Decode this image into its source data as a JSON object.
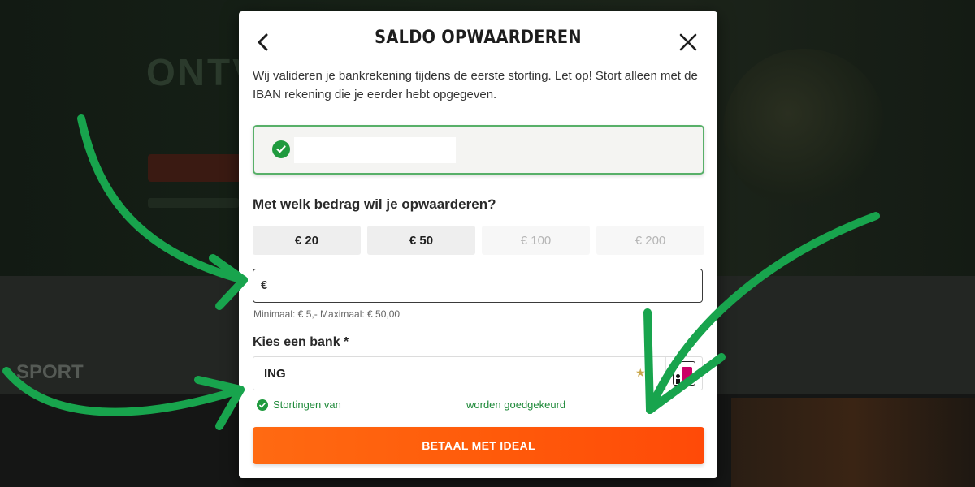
{
  "background": {
    "hero_title": "ONTVA",
    "section_label": "SPORT"
  },
  "modal": {
    "title": "SALDO OPWAARDEREN",
    "back_icon": "chevron-left-icon",
    "close_icon": "close-icon",
    "intro": "Wij valideren je bankrekening tijdens de eerste storting. Let op! Stort alleen met de IBAN rekening die je eerder hebt opgegeven.",
    "account_verified_icon": "check-circle-icon",
    "amount_question": "Met welk bedrag wil je opwaarderen?",
    "amount_options": [
      {
        "label": "€ 20",
        "state": "enabled"
      },
      {
        "label": "€ 50",
        "state": "enabled"
      },
      {
        "label": "€ 100",
        "state": "disabled"
      },
      {
        "label": "€ 200",
        "state": "disabled"
      }
    ],
    "amount_input": {
      "currency": "€",
      "value": ""
    },
    "limits_text": "Minimaal: € 5,- Maximaal: € 50,00",
    "bank_label": "Kies een bank *",
    "bank_value": "ING",
    "deposit_status_part1": "Stortingen van",
    "deposit_status_part2": "worden goedgekeurd",
    "pay_button": "BETAAL MET IDEAL"
  },
  "colors": {
    "accent_orange": "#ff5a0a",
    "success_green": "#1f9a3e",
    "annotation_green": "#18a44d"
  }
}
